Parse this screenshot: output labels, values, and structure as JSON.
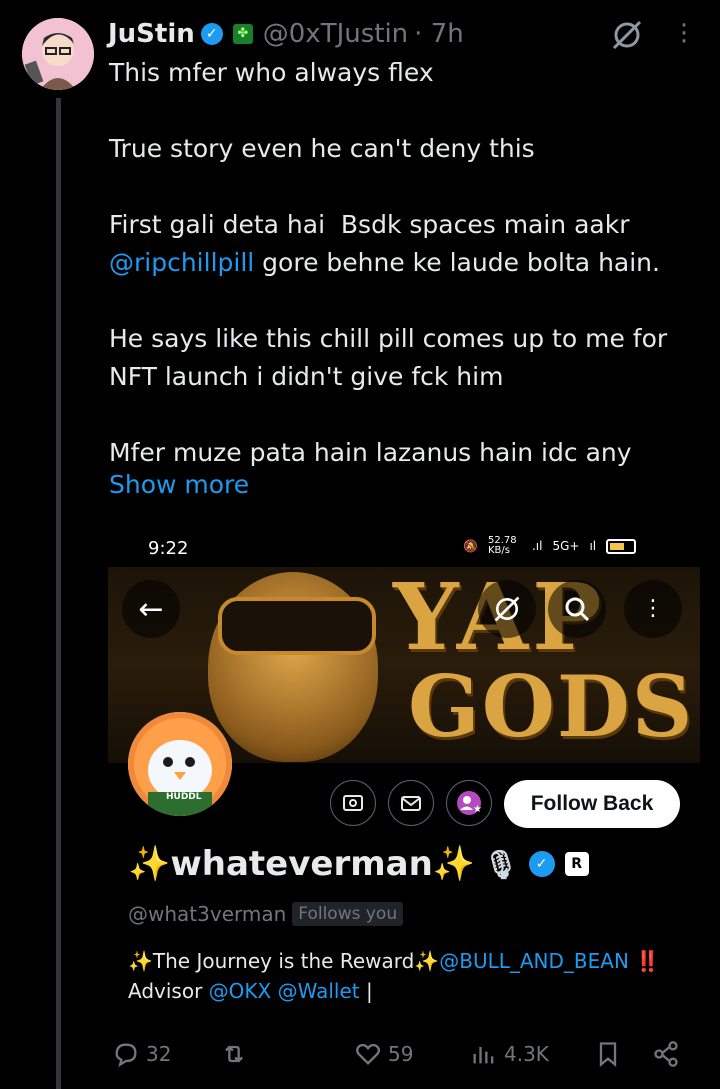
{
  "tweet": {
    "author_name": "JuStin",
    "author_handle": "@0xTJustin",
    "time": "· 7h",
    "text_lines": [
      "This mfer who always flex",
      "",
      "True story even he can't deny this",
      "",
      "First gali deta hai  Bsdk spaces main aakr"
    ],
    "mention": "@ripchillpill",
    "text_after_mention": " gore behne ke laude bolta hain.",
    "text_lines_2": [
      "",
      "He says like this chill pill comes up to me for",
      "NFT launch i didn't give fck him",
      "",
      "Mfer muze pata hain lazanus hain idc any"
    ],
    "show_more": "Show more"
  },
  "screenshot": {
    "status_time": "9:22",
    "net_speed": "52.78 KB/s",
    "network": "5G+",
    "banner_line1": "YAP",
    "banner_line2": "GODS",
    "follow_button": "Follow Back",
    "display_name": "whateverman",
    "sparkle": "✨",
    "handle": "@what3verman",
    "follows_you": "Follows you",
    "bio_part1": "✨The Journey is the Reward✨",
    "bio_mention1": "@BULL_AND_BEAN",
    "bio_exclaim": "‼️",
    "bio_advisor": "Advisor ",
    "bio_mention2": "@OKX",
    "bio_mention3": "@Wallet",
    "bio_cursor": "|",
    "pfp_badge_text": "HUDDL"
  },
  "stats": {
    "replies": "32",
    "likes": "59",
    "views": "4.3K"
  }
}
